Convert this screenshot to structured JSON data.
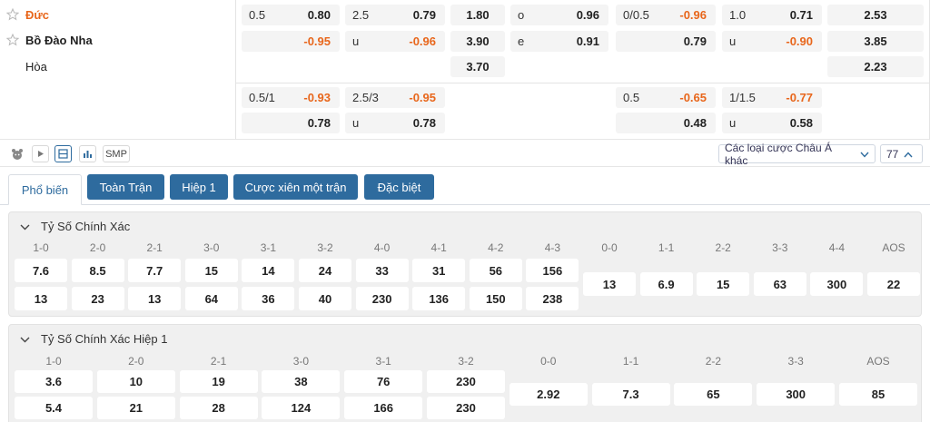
{
  "teams": {
    "home": "Đức",
    "away": "Bồ Đào Nha",
    "draw": "Hòa"
  },
  "colors": {
    "accent_orange": "#e8661b",
    "tab_blue": "#2e6b9e"
  },
  "odds_row1": {
    "g1_a_label": "0.5",
    "g1_a_val": "0.80",
    "g1_b_val": "-0.95",
    "g2_a_label": "2.5",
    "g2_a_val": "0.79",
    "g2_b_label": "u",
    "g2_b_val": "-0.96",
    "x12_a": "1.80",
    "x12_b": "3.90",
    "x12_c": "3.70",
    "oe_a_label": "o",
    "oe_a_val": "0.96",
    "oe_b_label": "e",
    "oe_b_val": "0.91",
    "h1_a_label": "0/0.5",
    "h1_a_val": "-0.96",
    "h1_b_val": "0.79",
    "h2_a_label": "1.0",
    "h2_a_val": "0.71",
    "h2_b_label": "u",
    "h2_b_val": "-0.90",
    "h12_a": "2.53",
    "h12_b": "3.85",
    "h12_c": "2.23"
  },
  "odds_row2": {
    "g1_a_label": "0.5/1",
    "g1_a_val": "-0.93",
    "g1_b_val": "0.78",
    "g2_a_label": "2.5/3",
    "g2_a_val": "-0.95",
    "g2_b_label": "u",
    "g2_b_val": "0.78",
    "h1_a_label": "0.5",
    "h1_a_val": "-0.65",
    "h1_b_val": "0.48",
    "h2_a_label": "1/1.5",
    "h2_a_val": "-0.77",
    "h2_b_label": "u",
    "h2_b_val": "0.58"
  },
  "toolbar": {
    "smp_label": "SMP",
    "market_select": "Các loại cược Châu Á khác",
    "count": "77"
  },
  "tabs": [
    "Phổ biến",
    "Toàn Trận",
    "Hiệp 1",
    "Cược xiên một trận",
    "Đặc biệt"
  ],
  "panel1": {
    "title": "Tỷ Số Chính Xác",
    "headers": [
      "1-0",
      "2-0",
      "2-1",
      "3-0",
      "3-1",
      "3-2",
      "4-0",
      "4-1",
      "4-2",
      "4-3",
      "0-0",
      "1-1",
      "2-2",
      "3-3",
      "4-4",
      "AOS"
    ],
    "home_row": [
      "7.6",
      "8.5",
      "7.7",
      "15",
      "14",
      "24",
      "33",
      "31",
      "56",
      "156"
    ],
    "away_row": [
      "13",
      "23",
      "13",
      "64",
      "36",
      "40",
      "230",
      "136",
      "150",
      "238"
    ],
    "draw_row": [
      "13",
      "6.9",
      "15",
      "63",
      "300",
      "22"
    ]
  },
  "panel2": {
    "title": "Tỷ Số Chính Xác Hiệp 1",
    "headers": [
      "1-0",
      "2-0",
      "2-1",
      "3-0",
      "3-1",
      "3-2",
      "0-0",
      "1-1",
      "2-2",
      "3-3",
      "AOS"
    ],
    "home_row": [
      "3.6",
      "10",
      "19",
      "38",
      "76",
      "230"
    ],
    "away_row": [
      "5.4",
      "21",
      "28",
      "124",
      "166",
      "230"
    ],
    "draw_row": [
      "2.92",
      "7.3",
      "65",
      "300",
      "85"
    ]
  }
}
